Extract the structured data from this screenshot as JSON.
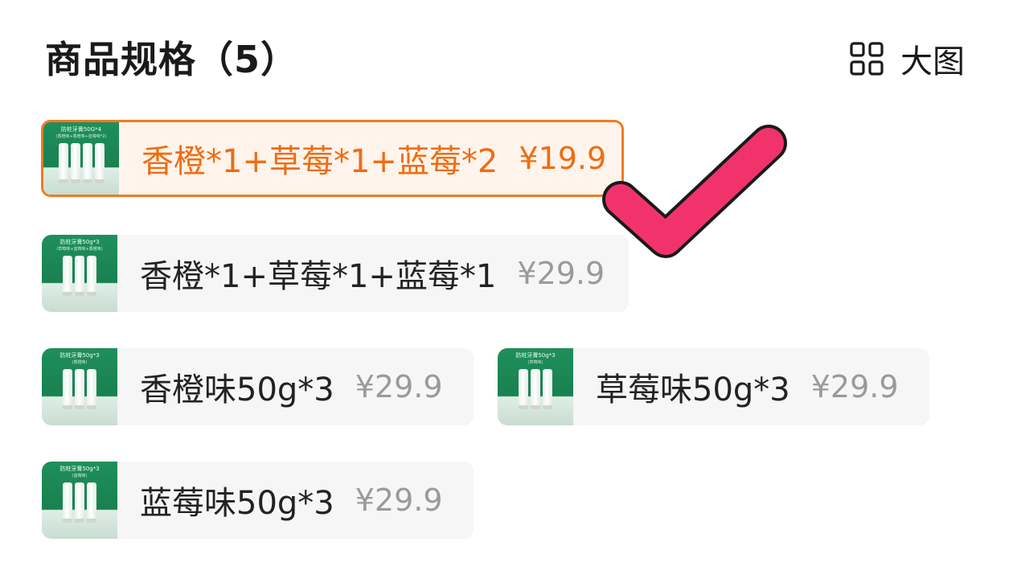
{
  "header": {
    "title": "商品规格（5）",
    "view_toggle_label": "大图",
    "view_toggle_icon": "grid-icon"
  },
  "skus": [
    {
      "name": "香橙*1+草莓*1+蓝莓*2",
      "price": "¥19.9",
      "selected": true,
      "thumb_text": "防蛀牙膏50G*4",
      "thumb_sub": "(香橙味+香橙味+蓝莓味*2)"
    },
    {
      "name": "香橙*1+草莓*1+蓝莓*1",
      "price": "¥29.9",
      "selected": false,
      "thumb_text": "防蛀牙膏50g*3",
      "thumb_sub": "(草莓味+蓝莓味+香橙味)"
    },
    {
      "name": "香橙味50g*3",
      "price": "¥29.9",
      "selected": false,
      "thumb_text": "防蛀牙膏50g*3",
      "thumb_sub": "(香橙味)"
    },
    {
      "name": "草莓味50g*3",
      "price": "¥29.9",
      "selected": false,
      "thumb_text": "防蛀牙膏50g*3",
      "thumb_sub": "(草莓味)"
    },
    {
      "name": "蓝莓味50g*3",
      "price": "¥29.9",
      "selected": false,
      "thumb_text": "防蛀牙膏50g*3",
      "thumb_sub": "(蓝莓味)"
    }
  ],
  "overlay": {
    "icon": "check-mark-icon",
    "color": "#f2336b"
  },
  "colors": {
    "accent": "#ef6c12",
    "selected_border": "#f27a21",
    "selected_bg": "#fff4ec",
    "price_gray": "#9a9a9a",
    "thumb_green": "#1f8f5c"
  }
}
